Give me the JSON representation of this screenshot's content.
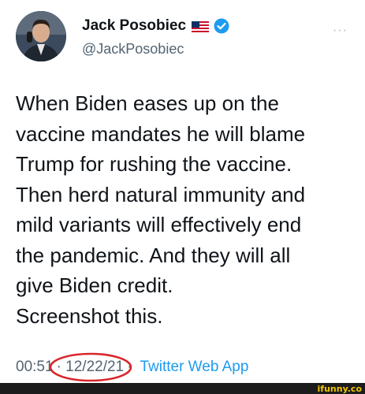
{
  "author": {
    "name": "Jack Posobiec",
    "handle": "@JackPosobiec"
  },
  "more_label": "···",
  "tweet": {
    "text": "When Biden eases up on the\nvaccine mandates he will blame\nTrump for rushing the vaccine.\nThen herd natural immunity and\nmild variants will effectively end\nthe pandemic. And they will all\ngive Biden credit.\nScreenshot this."
  },
  "meta": {
    "time": "00:51",
    "separator": "·",
    "date": "12/22/21",
    "app": "Twitter Web App"
  },
  "watermark": "ifunny.co",
  "icons": [
    "us-flag-icon",
    "verified-badge-icon"
  ],
  "colors": {
    "link": "#1d9bf0",
    "circle": "#d9262a",
    "verified": "#1d9bf0"
  }
}
